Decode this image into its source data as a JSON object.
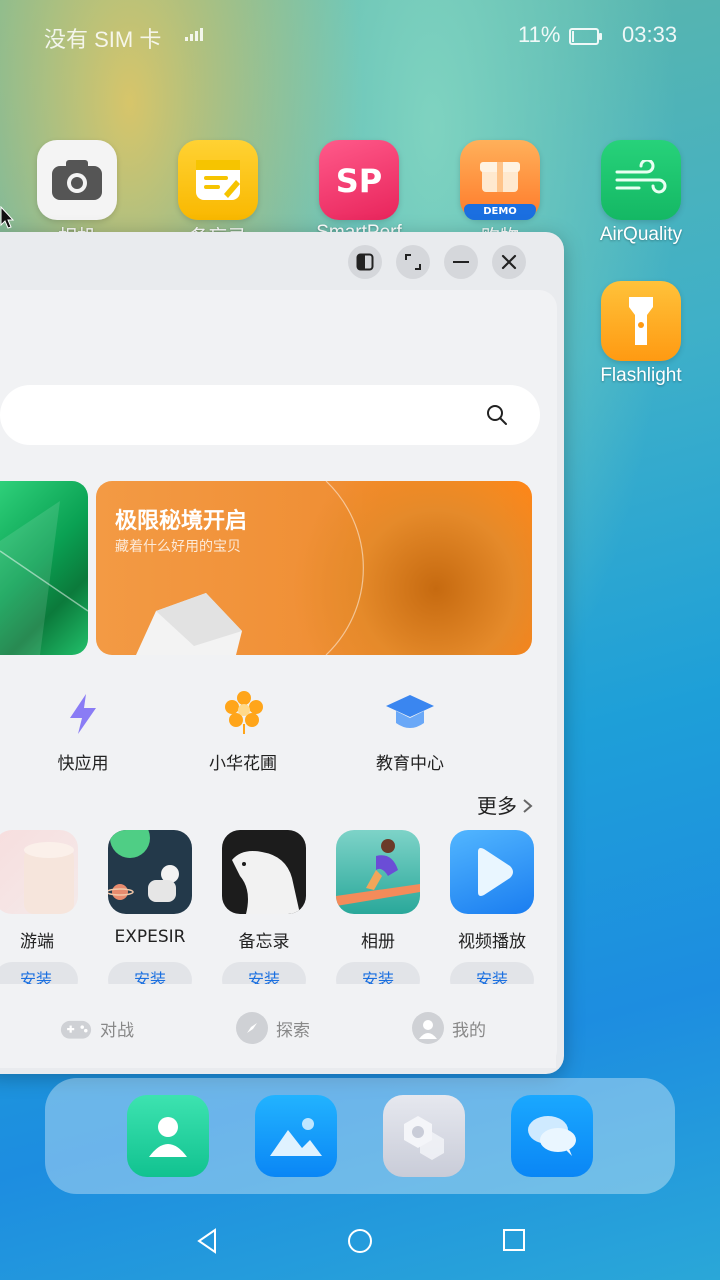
{
  "status_bar": {
    "carrier": "没有 SIM 卡",
    "battery": "11%",
    "battery_level": 0.11,
    "time": "03:33"
  },
  "home_apps": [
    {
      "label": "相机",
      "icon": "camera-icon"
    },
    {
      "label": "备忘录",
      "icon": "memo-icon"
    },
    {
      "label": "SmartPerf",
      "icon": "smartperf-icon"
    },
    {
      "label": "购物",
      "icon": "shopping-icon"
    },
    {
      "label": "AirQuality",
      "icon": "wind-icon"
    },
    {
      "label": "Flashlight",
      "icon": "flashlight-icon"
    }
  ],
  "shop_badge": "DEMO",
  "window": {
    "controls": [
      "split-screen-icon",
      "maximize-icon",
      "minimize-icon",
      "close-icon"
    ]
  },
  "search": {
    "icon": "search-icon"
  },
  "banner": {
    "title": "极限秘境开启",
    "subtitle": "藏着什么好用的宝贝"
  },
  "quick_entries": [
    {
      "label": "快应用",
      "icon": "lightning-icon"
    },
    {
      "label": "小华花圃",
      "icon": "flower-icon"
    },
    {
      "label": "教育中心",
      "icon": "graduation-cap-icon"
    }
  ],
  "more_label": "更多",
  "games": [
    {
      "name": "游端",
      "action": "安装"
    },
    {
      "name": "EXPESIR",
      "action": "安装"
    },
    {
      "name": "备忘录",
      "action": "安装"
    },
    {
      "name": "相册",
      "action": "安装"
    },
    {
      "name": "视频播放",
      "action": "安装"
    }
  ],
  "tabs": [
    {
      "label": "对战",
      "icon": "gamepad-icon"
    },
    {
      "label": "探索",
      "icon": "compass-icon"
    },
    {
      "label": "我的",
      "icon": "user-icon"
    }
  ],
  "dock": [
    "contacts-icon",
    "gallery-icon",
    "settings-hex-icon",
    "messages-icon"
  ],
  "colors": {
    "accent_blue": "#1a6fe0",
    "banner_orange": "#f08f35"
  }
}
